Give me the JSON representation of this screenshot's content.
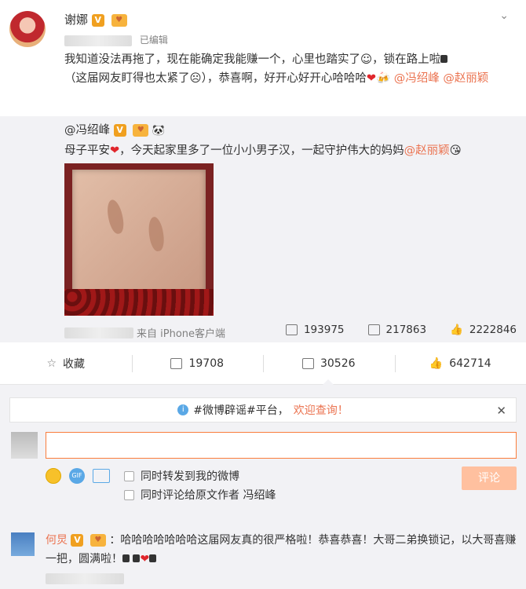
{
  "post": {
    "author": "谢娜",
    "vip_badge": "V",
    "edited": "已编辑",
    "text_1": "我知道没法再拖了，现在能确定我能赚一个，心里也踏实了☺，锁在路上啦",
    "text_2": "（这届网友盯得也太紧了☹），恭喜啊，好开心好开心哈哈哈",
    "mention_1": "@冯绍峰",
    "mention_2": "@赵丽颖",
    "more_icon": "chevron-down-icon"
  },
  "repost": {
    "author": "@冯绍峰",
    "vip_badge": "V",
    "text": "母子平安",
    "text_2": "，今天起家里多了一位小小男子汉，一起守护伟大的妈妈",
    "mention": "@赵丽颖",
    "source": "来自 iPhone客户端",
    "forwards": "193975",
    "comments": "217863",
    "likes": "2222846"
  },
  "actions": {
    "favorite": "收藏",
    "forward": "19708",
    "comment": "30526",
    "like": "642714"
  },
  "composer": {
    "notice_prefix": "#微博辟谣#平台，",
    "notice_highlight": "欢迎查询！",
    "check_1": "同时转发到我的微博",
    "check_2": "同时评论给原文作者 冯绍峰",
    "submit": "评论",
    "gif_label": "GIF"
  },
  "comment_1": {
    "author": "何炅",
    "vip_badge": "V",
    "text": "：哈哈哈哈哈哈哈这届网友真的很严格啦！恭喜恭喜！大哥二弟换锁记，以大哥喜赚一把，圆满啦！"
  },
  "colors": {
    "accent": "#eb7350",
    "vip": "#f0a020",
    "heart": "#e0262c"
  }
}
